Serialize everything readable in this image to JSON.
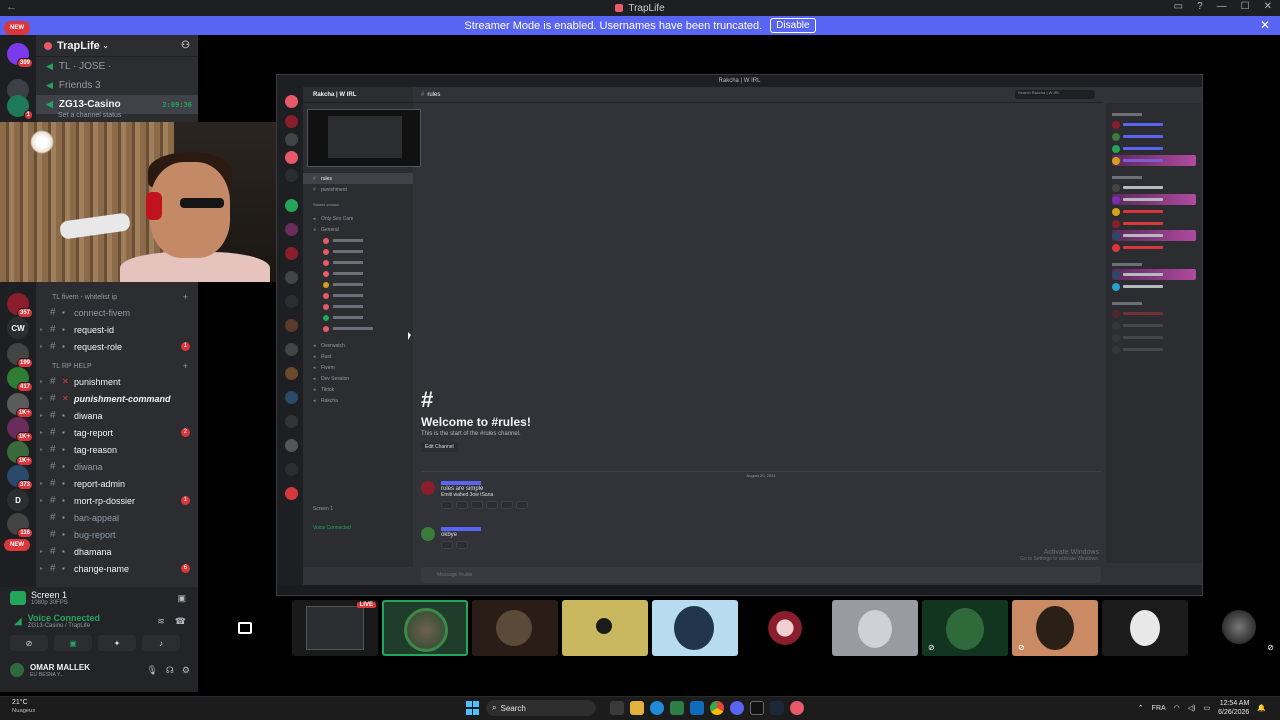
{
  "window": {
    "title": "TrapLife"
  },
  "streamer_banner": {
    "text": "Streamer Mode is enabled. Usernames have been truncated.",
    "button": "Disable"
  },
  "server_rail": {
    "new_badge": "NEW",
    "badges": [
      "20",
      "309",
      "1",
      "357",
      "CW",
      "199",
      "417",
      "1K+",
      "1K+",
      "1K+",
      "373",
      "D",
      "116",
      "NEW"
    ]
  },
  "guild": {
    "name": "TrapLife",
    "voice_channels": [
      {
        "name": "TL  ·  JOSE  ·",
        "active": false
      },
      {
        "name": "Friends 3",
        "active": false
      },
      {
        "name": "ZG13-Casino",
        "active": true,
        "time": "2:09:36"
      }
    ],
    "channel_status": "Set a channel status"
  },
  "channel_list": {
    "categories": [
      {
        "label": "TL fivem - whitelist ip",
        "channels": [
          {
            "name": "connect-fivem",
            "emoji": "▪",
            "style": "muted"
          },
          {
            "name": "request-id",
            "emoji": "▪",
            "style": "bright"
          },
          {
            "name": "request-role",
            "emoji": "▪",
            "style": "bright",
            "mention": "1"
          }
        ]
      },
      {
        "label": "TL RP HELP",
        "channels": [
          {
            "name": "punishment",
            "emoji": "✕",
            "style": "bright"
          },
          {
            "name": "punishment-command",
            "emoji": "✕",
            "style": "boldit"
          },
          {
            "name": "diwana",
            "emoji": "▪",
            "style": "bright"
          },
          {
            "name": "tag-report",
            "emoji": "▪",
            "style": "bright",
            "mention": "2"
          },
          {
            "name": "tag-reason",
            "emoji": "▪",
            "style": "bright"
          },
          {
            "name": "diwana",
            "emoji": "▪",
            "style": "muted"
          },
          {
            "name": "report-admin",
            "emoji": "▪",
            "style": "bright"
          },
          {
            "name": "mort-rp-dossier",
            "emoji": "▪",
            "style": "bright",
            "mention": "1"
          },
          {
            "name": "ban-appeal",
            "emoji": "▪",
            "style": "muted"
          },
          {
            "name": "bug-report",
            "emoji": "▪",
            "style": "muted"
          },
          {
            "name": "dhamana",
            "emoji": "▪",
            "style": "bright"
          },
          {
            "name": "change-name",
            "emoji": "▪",
            "style": "bright",
            "mention": "6"
          }
        ]
      }
    ]
  },
  "user_area": {
    "screen_label": "Screen 1",
    "screen_sub": "1080p 30FPS",
    "voice_title": "Voice Connected",
    "voice_sub": "ZG13-Casino / TrapLife",
    "username": "OMAR MALLEK",
    "user_status": "ELI BESNA Y..."
  },
  "stream": {
    "window_title": "Rakcha | W IRL",
    "guild_name": "Rakcha | W IRL",
    "channel_header": "rules",
    "search_placeholder": "Search Rakcha | W IRL",
    "channels": [
      "rules",
      "punishment"
    ],
    "category": "Salons vocaux",
    "voice": [
      "Only Sex Cam",
      "General",
      "Overwatch",
      "Rust",
      "Fivem",
      "Dev Session",
      "Tiktok",
      "Rakcha"
    ],
    "welcome_hash": "#",
    "welcome_title": "Welcome to #rules!",
    "welcome_sub": "This is the start of the #rules channel.",
    "edit_label": "Edit Channel",
    "date": "August 20, 2024",
    "msg1_lines": [
      "rules are simple",
      "Emiti wahed 3ow tSana"
    ],
    "msg2_line": "okbye",
    "composer_placeholder": "Message #rules",
    "activate_title": "Activate Windows",
    "activate_sub": "Go to Settings to activate Windows.",
    "screen_label": "Screen 1",
    "voice_connected": "Voice Connected"
  },
  "tiles": {
    "live_label": "LIVE"
  },
  "taskbar": {
    "weather_temp": "21°C",
    "weather_desc": "Nuageux",
    "search_label": "Search",
    "lang": "FRA",
    "time": "12:54 AM",
    "date": "6/26/2026"
  }
}
